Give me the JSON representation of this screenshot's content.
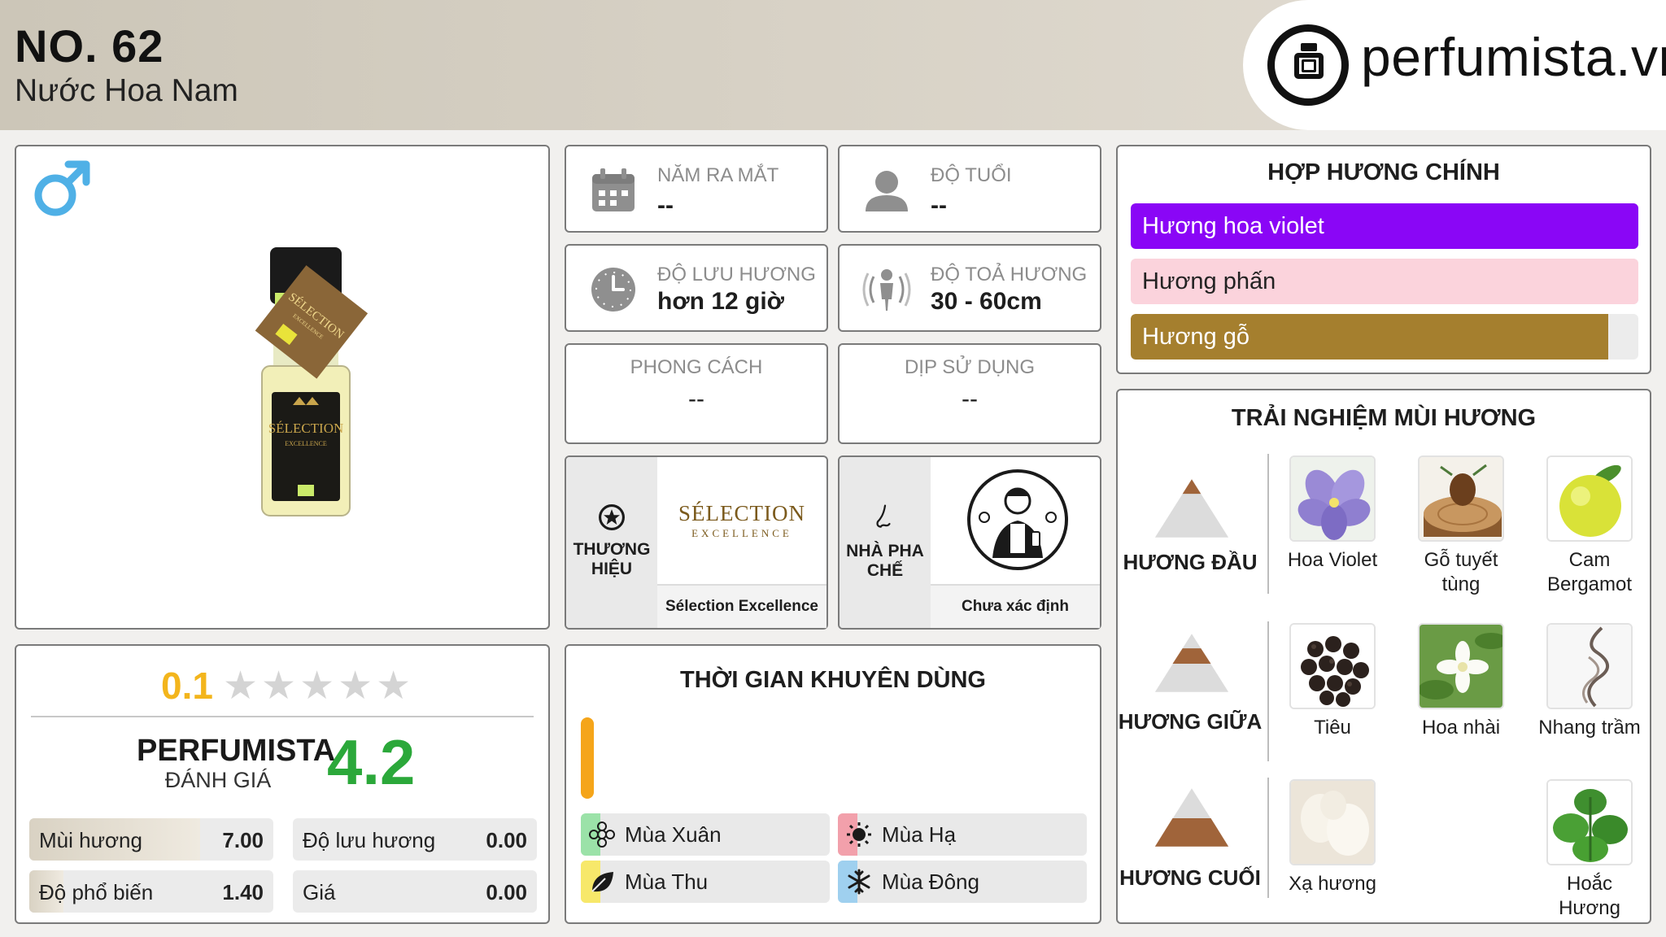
{
  "header": {
    "title": "NO. 62",
    "subtitle": "Nước Hoa Nam"
  },
  "logo": {
    "text": "perfumista.vn"
  },
  "gender": {
    "icon": "male-symbol-icon",
    "color": "#4fb0e6"
  },
  "rating": {
    "user_score": "0.1",
    "user_stars": 0.1,
    "brand_label": "PERFUMISTA",
    "brand_sublabel": "ĐÁNH GIÁ",
    "brand_score": "4.2",
    "scores": [
      {
        "name": "Mùi hương",
        "value": "7.00",
        "fill": 0.7
      },
      {
        "name": "Độ lưu hương",
        "value": "0.00",
        "fill": 0
      },
      {
        "name": "Độ phổ biến",
        "value": "1.40",
        "fill": 0.14
      },
      {
        "name": "Giá",
        "value": "0.00",
        "fill": 0
      }
    ]
  },
  "info": {
    "release": {
      "label": "NĂM RA MẮT",
      "value": "--",
      "icon": "calendar-icon"
    },
    "age": {
      "label": "ĐỘ TUỔI",
      "value": "--",
      "icon": "person-icon"
    },
    "longevity": {
      "label": "ĐỘ LƯU HƯƠNG",
      "value": "hơn 12 giờ",
      "icon": "clock-icon"
    },
    "sillage": {
      "label": "ĐỘ TOẢ HƯƠNG",
      "value": "30 - 60cm",
      "icon": "sillage-icon"
    },
    "style": {
      "label": "PHONG CÁCH",
      "value": "--"
    },
    "occasion": {
      "label": "DỊP SỬ DỤNG",
      "value": "--"
    }
  },
  "brand": {
    "side_label_1": "THƯƠNG",
    "side_label_2": "HIỆU",
    "logo_line_1": "SÉLECTION",
    "logo_line_2": "EXCELLENCE",
    "name": "Sélection Excellence"
  },
  "perfumer": {
    "side_label_1": "NHÀ PHA",
    "side_label_2": "CHẾ",
    "name": "Chưa xác định"
  },
  "accords": {
    "title": "HỢP HƯƠNG CHÍNH",
    "items": [
      {
        "name": "Hương hoa violet",
        "color": "#8a06f6",
        "fill": 1.0,
        "text_color": "#ffffff"
      },
      {
        "name": "Hương phấn",
        "color": "#fbd3dc",
        "fill": 1.0,
        "text_color": "#222222"
      },
      {
        "name": "Hương gỗ",
        "color": "#a57f2e",
        "fill": 0.94,
        "text_color": "#ffffff"
      }
    ]
  },
  "seasons": {
    "title": "THỜI GIAN KHUYÊN DÙNG",
    "day_indicator_color": "#f5a51a",
    "items": [
      {
        "name": "Mùa Xuân",
        "color": "#9be2a8",
        "icon": "flower-icon"
      },
      {
        "name": "Mùa Hạ",
        "color": "#f2a0ab",
        "icon": "sun-icon"
      },
      {
        "name": "Mùa Thu",
        "color": "#f7e86a",
        "icon": "leaf-icon"
      },
      {
        "name": "Mùa Đông",
        "color": "#9fd0ef",
        "icon": "snowflake-icon"
      }
    ]
  },
  "notes": {
    "title": "TRẢI NGHIỆM MÙI HƯƠNG",
    "top": {
      "label": "HƯƠNG ĐẦU",
      "items": [
        "Hoa Violet",
        "Gỗ tuyết tùng",
        "Cam Bergamot"
      ]
    },
    "middle": {
      "label": "HƯƠNG GIỮA",
      "items": [
        "Tiêu",
        "Hoa nhài",
        "Nhang trầm"
      ]
    },
    "base": {
      "label": "HƯƠNG CUỐI",
      "items": [
        "Xạ hương",
        "Hoắc Hương"
      ]
    }
  }
}
